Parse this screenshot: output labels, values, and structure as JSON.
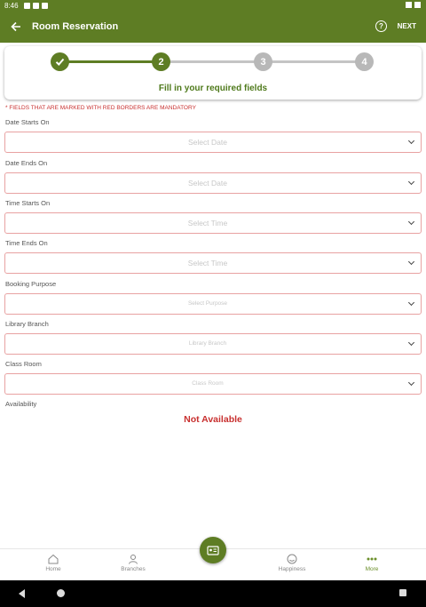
{
  "status_bar": {
    "time": "8:46"
  },
  "app_bar": {
    "back_icon": "arrow-left-icon",
    "title": "Room Reservation",
    "help_icon": "?",
    "next_label": "NEXT"
  },
  "stepper": {
    "steps": [
      {
        "label": "",
        "state": "done"
      },
      {
        "label": "2",
        "state": "current"
      },
      {
        "label": "3",
        "state": "pending"
      },
      {
        "label": "4",
        "state": "pending"
      }
    ],
    "caption": "Fill in your required fields"
  },
  "form": {
    "mandatory_note": "* FIELDS THAT ARE MARKED WITH RED BORDERS ARE MANDATORY",
    "fields": [
      {
        "label": "Date Starts On",
        "placeholder": "Select Date"
      },
      {
        "label": "Date Ends On",
        "placeholder": "Select Date"
      },
      {
        "label": "Time Starts On",
        "placeholder": "Select Time"
      },
      {
        "label": "Time Ends On",
        "placeholder": "Select Time"
      },
      {
        "label": "Booking Purpose",
        "placeholder": "Select Purpose"
      },
      {
        "label": "Library Branch",
        "placeholder": "Library Branch"
      },
      {
        "label": "Class Room",
        "placeholder": "Class Room"
      }
    ],
    "availability_label": "Availability",
    "availability_value": "Not Available"
  },
  "bottom_nav": {
    "items": [
      {
        "label": "Home",
        "icon": "home-icon"
      },
      {
        "label": "Branches",
        "icon": "branches-icon"
      },
      {
        "label": "Happiness",
        "icon": "smile-icon"
      },
      {
        "label": "More",
        "icon": "more-dots-icon"
      }
    ],
    "fab_icon": "id-card-icon"
  },
  "colors": {
    "primary": "#5e7d24",
    "accent_text": "#4f7a1c",
    "error": "#c8302f",
    "pending": "#b8b8b8",
    "field_border": "#e8a2a2"
  }
}
